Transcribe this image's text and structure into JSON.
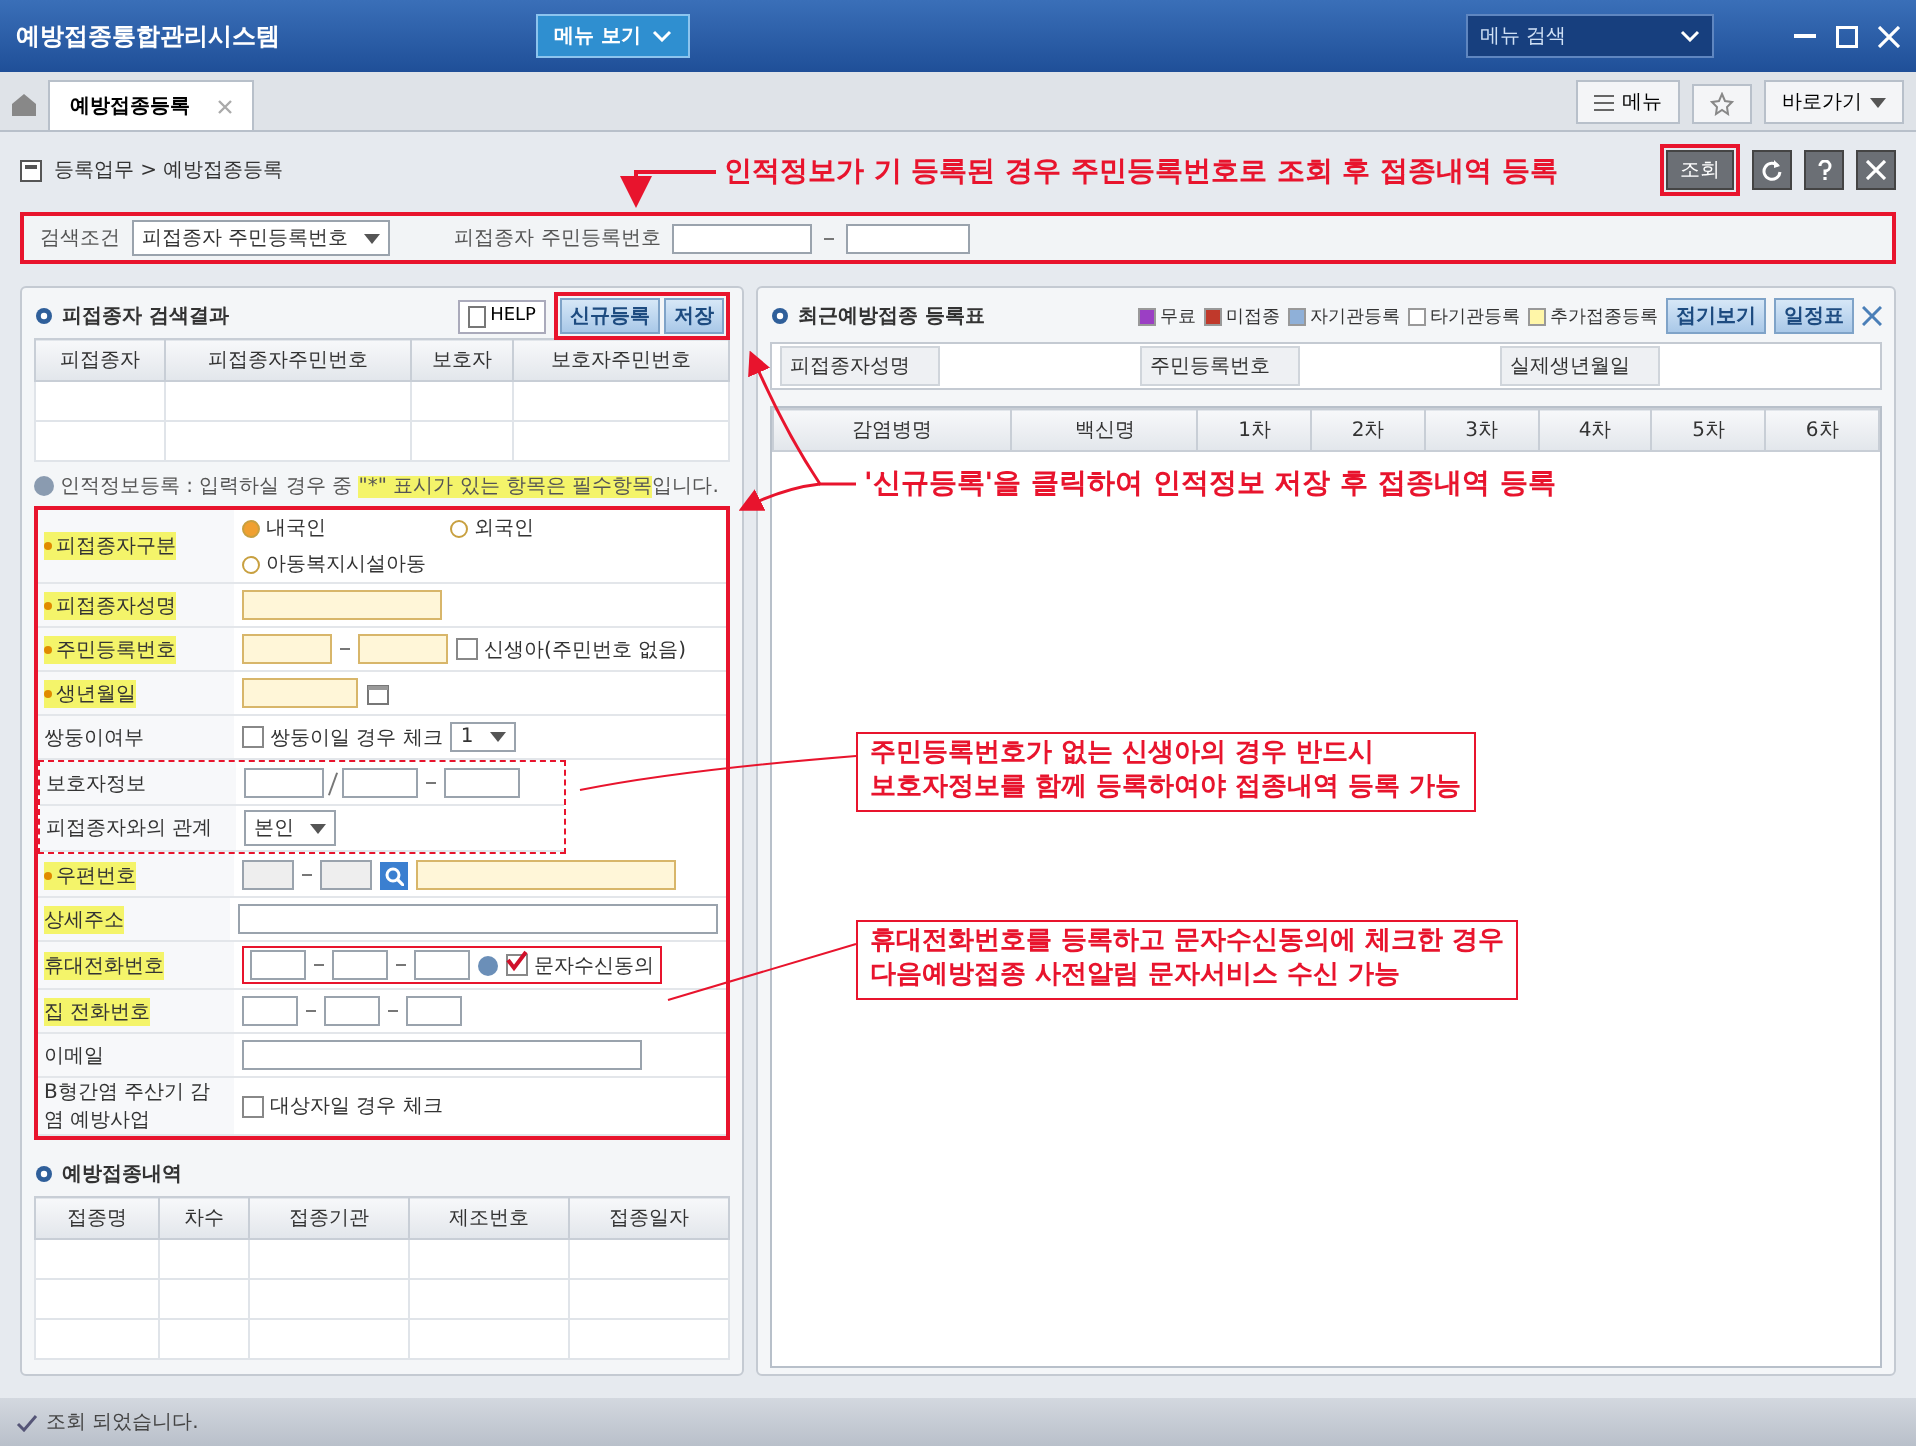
{
  "window": {
    "title": "예방접종통합관리시스템",
    "menu_button": "메뉴 보기",
    "menu_search": "메뉴 검색"
  },
  "tabs": [
    {
      "label": "예방접종등록",
      "selected": true
    }
  ],
  "toolbar": {
    "menu": "메뉴",
    "shortcut": "바로가기"
  },
  "breadcrumb": "등록업무 > 예방접종등록",
  "page_buttons": [
    "조회"
  ],
  "search": {
    "condition_label": "검색조건",
    "condition_value": "피접종자 주민등록번호",
    "number_label": "피접종자 주민등록번호"
  },
  "results": {
    "title": "피접종자 검색결과",
    "buttons": [
      "HELP",
      "신규등록",
      "저장"
    ],
    "columns": [
      "피접종자",
      "피접종자주민번호",
      "보호자",
      "보호자주민번호"
    ]
  },
  "personal": {
    "title": "인적정보등록 : 입력하실 경우 중 ",
    "note_highlight": "\"*\" 표시가 있는 항목은 필수항목",
    "note_after": "입니다.",
    "fields": [
      {
        "kind": "radio",
        "label": "피접종자구분",
        "required": true,
        "highlight": true,
        "options": [
          {
            "label": "내국인",
            "selected": true
          },
          {
            "label": "외국인",
            "selected": false
          },
          {
            "label": "아동복지시설아동",
            "selected": false
          }
        ]
      },
      {
        "kind": "text",
        "label": "피접종자성명",
        "required": true,
        "highlight": true
      },
      {
        "kind": "ssn",
        "label": "주민등록번호",
        "required": true,
        "highlight": true,
        "checkbox": {
          "label": "신생아(주민번호 없음)",
          "checked": false
        }
      },
      {
        "kind": "date",
        "label": "생년월일",
        "required": true,
        "highlight": true
      },
      {
        "kind": "twin",
        "label": "쌍둥이여부",
        "required": false,
        "highlight": false,
        "checkbox": {
          "label": "쌍둥이일 경우 체크",
          "checked": false
        },
        "select": "1"
      },
      {
        "kind": "guardian",
        "label": "보호자정보",
        "required": false,
        "highlight": false,
        "framed_row": true
      },
      {
        "kind": "select",
        "label": "피접종자와의 관계",
        "required": false,
        "highlight": false,
        "value": "본인",
        "framed_row": true
      },
      {
        "kind": "postcode",
        "label": "우편번호",
        "required": true,
        "highlight": true
      },
      {
        "kind": "text",
        "label": "상세주소",
        "required": false,
        "highlight": true
      },
      {
        "kind": "phone",
        "label": "휴대전화번호",
        "required": false,
        "highlight": true,
        "checkbox": {
          "label": "문자수신동의",
          "checked": true
        },
        "framed_value": true
      },
      {
        "kind": "phone",
        "label": "집 전화번호",
        "required": false,
        "highlight": true
      },
      {
        "kind": "email",
        "label": "이메일",
        "required": false,
        "highlight": false
      },
      {
        "kind": "check",
        "label": "B형간염 주산기 감염 예방사업",
        "required": false,
        "highlight": false,
        "checkbox": {
          "label": "대상자일 경우 체크",
          "checked": false
        }
      }
    ]
  },
  "history": {
    "title": "예방접종내역",
    "columns": [
      "접종명",
      "차수",
      "접종기관",
      "제조번호",
      "접종일자"
    ]
  },
  "recent": {
    "title": "최근예방접종 등록표",
    "legend": [
      {
        "label": "무료",
        "color": "#9b3fc4"
      },
      {
        "label": "미접종",
        "color": "#c0392b"
      },
      {
        "label": "자기관등록",
        "color": "#8fb0d8"
      },
      {
        "label": "타기관등록",
        "color": "#ffffff"
      },
      {
        "label": "추가접종등록",
        "color": "#fff6a8"
      }
    ],
    "buttons": [
      "접기보기",
      "일정표"
    ],
    "info": [
      "피접종자성명",
      "주민등록번호",
      "실제생년월일"
    ],
    "columns": [
      "감염병명",
      "백신명",
      "1차",
      "2차",
      "3차",
      "4차",
      "5차",
      "6차"
    ]
  },
  "annotations": [
    {
      "text": "인적정보가 기 등록된 경우 주민등록번호로 조회 후 접종내역 등록"
    },
    {
      "text": "'신규등록'을 클릭하여 인적정보 저장 후 접종내역 등록"
    },
    {
      "text": "주민등록번호가 없는 신생아의 경우 반드시\n보호자정보를 함께 등록하여야 접종내역 등록 가능"
    },
    {
      "text": "휴대전화번호를 등록하고 문자수신동의에 체크한 경우\n다음예방접종 사전알림 문자서비스 수신 가능"
    }
  ],
  "status_bar": "조회 되었습니다."
}
